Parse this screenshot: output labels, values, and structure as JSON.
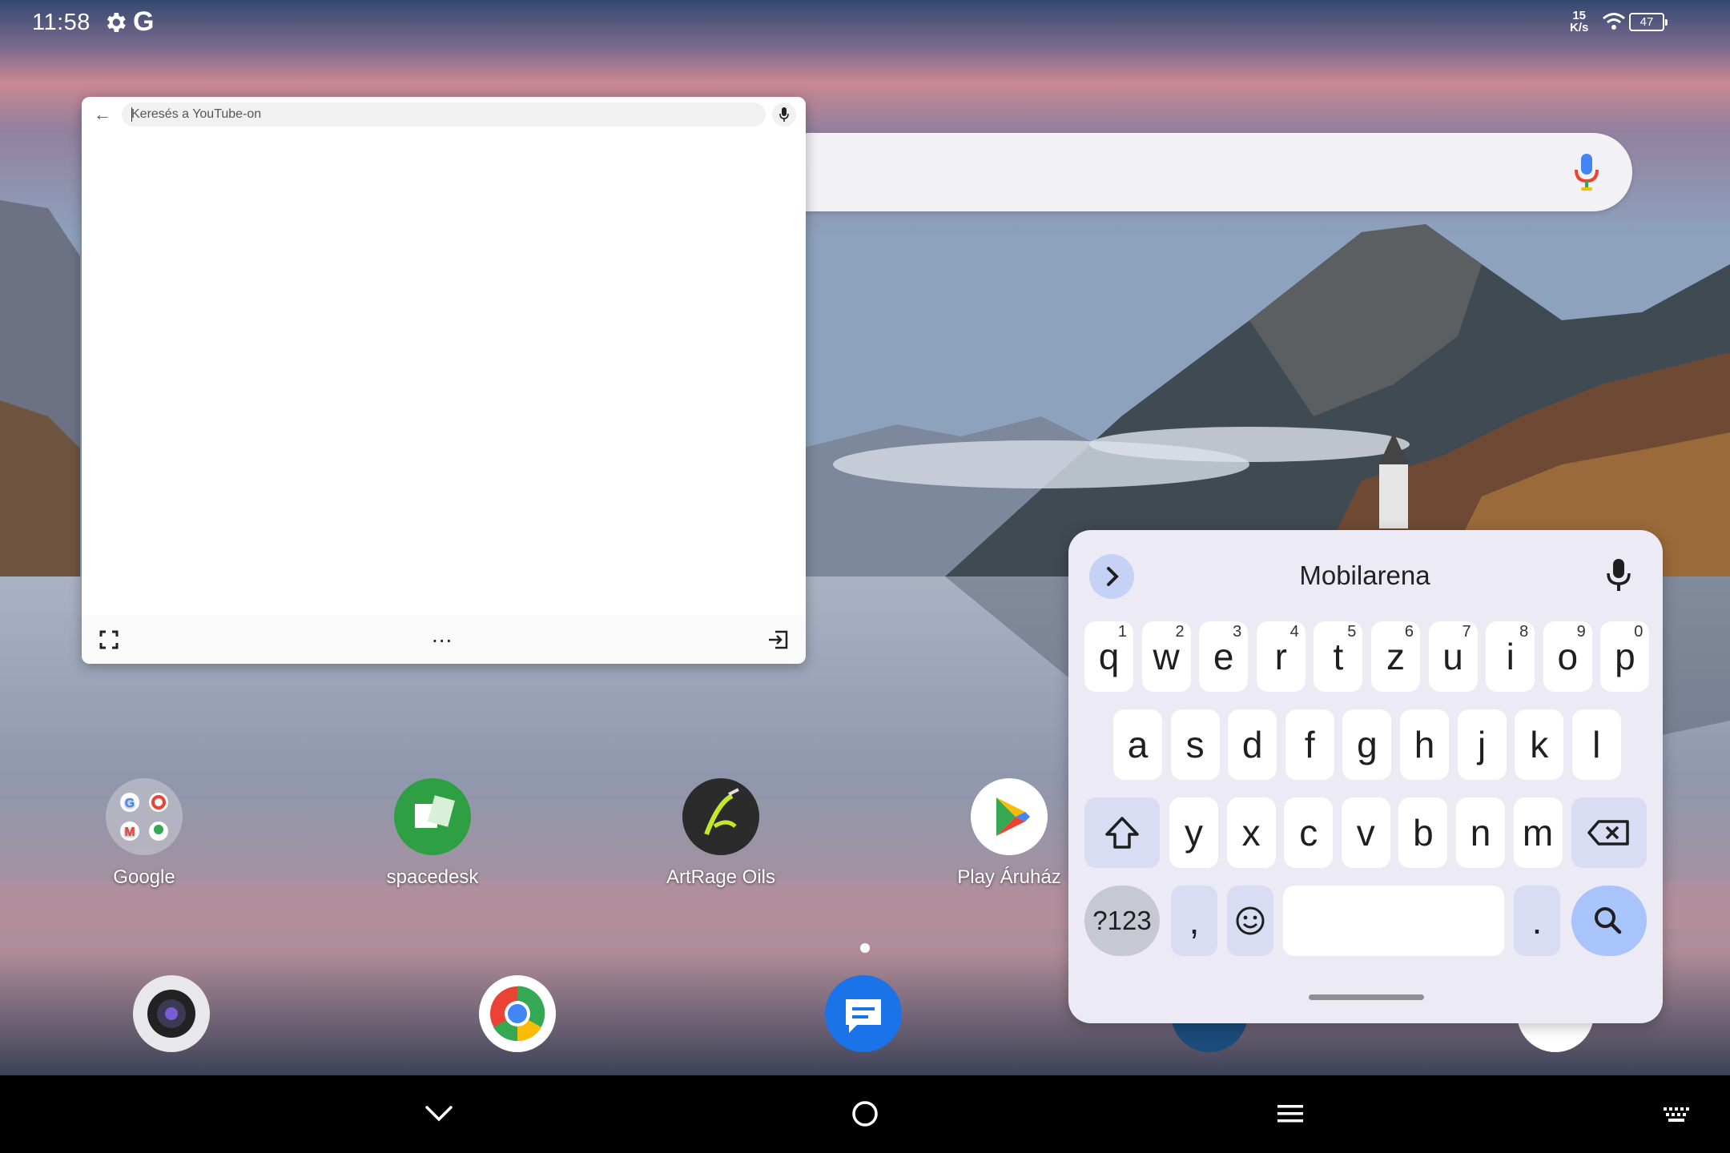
{
  "status_bar": {
    "time": "11:58",
    "g_label": "G",
    "net_speed_value": "15",
    "net_speed_unit": "K/s",
    "battery": "47"
  },
  "floating_window": {
    "search_placeholder": "Keresés a YouTube-on",
    "more_label": "..."
  },
  "apps": [
    {
      "label": "Google"
    },
    {
      "label": "spacedesk"
    },
    {
      "label": "ArtRage Oils"
    },
    {
      "label": "Play Áruház"
    }
  ],
  "keyboard": {
    "suggestion": "Mobilarena",
    "row1": [
      {
        "key": "q",
        "hint": "1"
      },
      {
        "key": "w",
        "hint": "2"
      },
      {
        "key": "e",
        "hint": "3"
      },
      {
        "key": "r",
        "hint": "4"
      },
      {
        "key": "t",
        "hint": "5"
      },
      {
        "key": "z",
        "hint": "6"
      },
      {
        "key": "u",
        "hint": "7"
      },
      {
        "key": "i",
        "hint": "8"
      },
      {
        "key": "o",
        "hint": "9"
      },
      {
        "key": "p",
        "hint": "0"
      }
    ],
    "row2": [
      "a",
      "s",
      "d",
      "f",
      "g",
      "h",
      "j",
      "k",
      "l"
    ],
    "row3": [
      "y",
      "x",
      "c",
      "v",
      "b",
      "n",
      "m"
    ],
    "symbols_label": "?123",
    "comma_label": ",",
    "period_label": "."
  },
  "colors": {
    "keyboard_bg": "#eceaf4",
    "function_key": "#d9ddf4",
    "search_key": "#a9c3fb"
  }
}
